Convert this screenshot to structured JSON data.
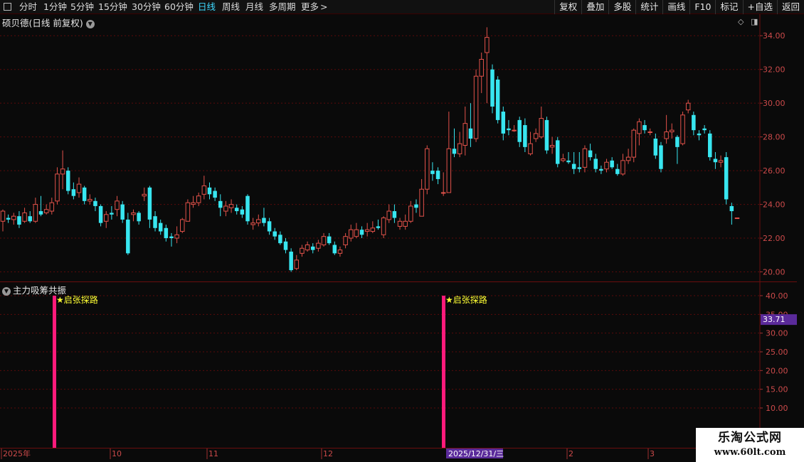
{
  "toolbar": {
    "periods": [
      "分时",
      "1分钟",
      "5分钟",
      "15分钟",
      "30分钟",
      "60分钟",
      "日线",
      "周线",
      "月线",
      "多周期",
      "更多"
    ],
    "active_period": "日线",
    "more_arrow": ">",
    "right_buttons": [
      "复权",
      "叠加",
      "多股",
      "统计",
      "画线",
      "F10",
      "标记",
      "+自选",
      "返回"
    ]
  },
  "main_chart": {
    "title": "硕贝德(日线 前复权)",
    "up_color": "#e2524a",
    "down_color": "#38e6f0",
    "grid_color": "#5a0a0a"
  },
  "indicator": {
    "title": "主力吸筹共振",
    "signal_label": "★启张探路",
    "signal_color": "#ff1a7a",
    "label_color": "#ffff33",
    "current_value": "33.71",
    "value_badge_color": "#5a2a9a"
  },
  "chart_data": [
    {
      "type": "candlestick",
      "title": "硕贝德(日线 前复权)",
      "y_ticks": [
        "34.00",
        "32.00",
        "30.00",
        "28.00",
        "26.00",
        "24.00",
        "22.00",
        "20.00"
      ],
      "ylim": [
        19.6,
        34.6
      ],
      "x_labels": [
        "2025年",
        "10",
        "11",
        "12",
        "2025/12/31/三",
        "2",
        "3"
      ],
      "candles": [
        [
          23.0,
          23.6,
          22.4,
          23.7
        ],
        [
          23.2,
          23.1,
          22.9,
          23.4
        ],
        [
          23.1,
          23.3,
          22.8,
          23.5
        ],
        [
          23.3,
          22.8,
          22.6,
          23.6
        ],
        [
          23.0,
          23.5,
          22.9,
          23.8
        ],
        [
          23.3,
          23.0,
          22.9,
          23.6
        ],
        [
          23.0,
          24.0,
          22.9,
          24.4
        ],
        [
          23.6,
          23.4,
          23.3,
          24.5
        ],
        [
          23.5,
          23.7,
          23.4,
          24.0
        ],
        [
          23.6,
          24.1,
          23.4,
          24.4
        ],
        [
          24.2,
          25.8,
          24.0,
          26.2
        ],
        [
          25.8,
          26.1,
          24.9,
          27.2
        ],
        [
          26.0,
          24.8,
          24.6,
          26.2
        ],
        [
          24.9,
          24.5,
          24.3,
          25.3
        ],
        [
          24.7,
          25.2,
          24.4,
          25.6
        ],
        [
          25.0,
          24.2,
          24.0,
          25.1
        ],
        [
          24.2,
          24.3,
          24.0,
          24.6
        ],
        [
          24.2,
          23.9,
          23.6,
          24.4
        ],
        [
          23.9,
          22.9,
          22.7,
          24.0
        ],
        [
          23.0,
          23.4,
          22.6,
          23.6
        ],
        [
          23.5,
          23.4,
          23.1,
          23.9
        ],
        [
          23.7,
          24.2,
          23.3,
          24.5
        ],
        [
          24.0,
          23.1,
          22.9,
          24.2
        ],
        [
          23.1,
          21.1,
          21.0,
          23.5
        ],
        [
          23.4,
          23.5,
          23.0,
          23.7
        ],
        [
          23.5,
          23.0,
          22.8,
          23.6
        ],
        [
          24.5,
          24.6,
          24.2,
          25.0
        ],
        [
          25.0,
          23.1,
          22.6,
          25.1
        ],
        [
          23.3,
          22.6,
          22.4,
          23.6
        ],
        [
          22.9,
          22.4,
          22.2,
          23.1
        ],
        [
          22.6,
          22.0,
          21.8,
          22.8
        ],
        [
          22.1,
          22.0,
          21.5,
          22.3
        ],
        [
          22.0,
          22.2,
          21.7,
          22.7
        ],
        [
          22.4,
          23.1,
          22.3,
          23.2
        ],
        [
          23.0,
          24.1,
          23.0,
          24.3
        ],
        [
          24.0,
          24.1,
          23.8,
          24.5
        ],
        [
          24.1,
          24.5,
          23.9,
          24.7
        ],
        [
          24.6,
          25.1,
          24.3,
          25.7
        ],
        [
          25.0,
          24.6,
          24.3,
          25.3
        ],
        [
          24.8,
          24.4,
          24.2,
          25.0
        ],
        [
          24.2,
          23.8,
          23.3,
          24.6
        ],
        [
          23.6,
          23.9,
          23.3,
          24.2
        ],
        [
          23.8,
          24.0,
          23.5,
          24.3
        ],
        [
          23.8,
          23.6,
          23.4,
          24.0
        ],
        [
          23.7,
          23.4,
          23.2,
          23.9
        ],
        [
          24.5,
          23.0,
          22.8,
          24.6
        ],
        [
          22.8,
          22.9,
          22.5,
          23.2
        ],
        [
          22.9,
          23.1,
          22.7,
          23.4
        ],
        [
          23.2,
          22.9,
          22.7,
          23.8
        ],
        [
          23.0,
          22.4,
          22.2,
          23.2
        ],
        [
          22.4,
          22.1,
          21.9,
          22.6
        ],
        [
          22.2,
          21.7,
          21.6,
          22.4
        ],
        [
          21.8,
          21.3,
          21.1,
          22.0
        ],
        [
          21.2,
          20.1,
          20.0,
          21.4
        ],
        [
          20.2,
          20.7,
          20.1,
          21.0
        ],
        [
          21.1,
          21.4,
          20.9,
          21.6
        ],
        [
          21.3,
          21.6,
          21.2,
          21.8
        ],
        [
          21.5,
          21.3,
          21.1,
          21.7
        ],
        [
          21.4,
          21.7,
          21.2,
          21.9
        ],
        [
          21.6,
          22.1,
          21.5,
          22.3
        ],
        [
          22.1,
          21.7,
          21.6,
          22.3
        ],
        [
          21.6,
          21.1,
          21.0,
          21.8
        ],
        [
          21.1,
          21.3,
          20.9,
          21.5
        ],
        [
          21.6,
          22.1,
          21.4,
          22.3
        ],
        [
          22.0,
          22.5,
          21.8,
          22.8
        ],
        [
          22.1,
          22.5,
          22.0,
          22.9
        ],
        [
          22.5,
          22.2,
          22.0,
          22.7
        ],
        [
          22.4,
          22.5,
          22.1,
          22.9
        ],
        [
          22.4,
          22.6,
          22.3,
          23.0
        ],
        [
          22.7,
          22.6,
          22.5,
          23.1
        ],
        [
          22.2,
          23.2,
          22.0,
          23.3
        ],
        [
          23.1,
          23.6,
          22.9,
          24.0
        ],
        [
          23.6,
          23.2,
          22.9,
          24.0
        ],
        [
          22.7,
          23.0,
          22.5,
          23.2
        ],
        [
          22.7,
          23.0,
          22.5,
          23.4
        ],
        [
          23.0,
          23.9,
          22.9,
          24.2
        ],
        [
          24.0,
          23.8,
          23.5,
          24.3
        ],
        [
          23.3,
          24.9,
          23.3,
          25.5
        ],
        [
          24.9,
          27.3,
          24.6,
          27.5
        ],
        [
          26.0,
          25.8,
          25.4,
          26.5
        ],
        [
          26.0,
          25.5,
          25.2,
          26.2
        ],
        [
          24.7,
          24.7,
          24.5,
          25.9
        ],
        [
          24.7,
          27.3,
          24.7,
          29.5
        ],
        [
          27.3,
          27.0,
          26.8,
          28.5
        ],
        [
          27.0,
          27.6,
          26.8,
          28.3
        ],
        [
          27.5,
          28.8,
          26.9,
          29.8
        ],
        [
          28.5,
          27.9,
          27.4,
          30.0
        ],
        [
          27.9,
          31.6,
          27.7,
          32.0
        ],
        [
          31.6,
          32.6,
          30.6,
          33.0
        ],
        [
          33.0,
          33.9,
          30.0,
          34.5
        ],
        [
          32.0,
          29.8,
          29.4,
          32.3
        ],
        [
          31.4,
          29.0,
          28.8,
          31.6
        ],
        [
          29.5,
          28.2,
          27.8,
          29.8
        ],
        [
          28.5,
          28.4,
          28.1,
          29.0
        ],
        [
          28.4,
          28.4,
          28.3,
          28.7
        ],
        [
          29.0,
          27.7,
          27.4,
          29.2
        ],
        [
          28.7,
          27.4,
          27.1,
          29.1
        ],
        [
          27.0,
          27.6,
          26.9,
          28.3
        ],
        [
          27.9,
          28.2,
          27.7,
          28.5
        ],
        [
          28.0,
          29.1,
          27.9,
          29.8
        ],
        [
          29.0,
          27.2,
          27.0,
          29.2
        ],
        [
          27.4,
          27.5,
          27.0,
          28.0
        ],
        [
          27.8,
          26.4,
          26.2,
          28.0
        ],
        [
          26.6,
          26.7,
          26.5,
          27.0
        ],
        [
          26.6,
          26.5,
          26.4,
          27.1
        ],
        [
          26.4,
          26.1,
          25.8,
          27.1
        ],
        [
          26.2,
          26.1,
          25.9,
          27.1
        ],
        [
          26.2,
          27.3,
          25.9,
          27.5
        ],
        [
          27.2,
          26.8,
          26.6,
          27.6
        ],
        [
          26.7,
          26.1,
          25.9,
          27.0
        ],
        [
          26.1,
          26.0,
          25.8,
          26.3
        ],
        [
          26.1,
          26.5,
          25.9,
          26.7
        ],
        [
          26.6,
          26.2,
          26.1,
          26.8
        ],
        [
          26.1,
          25.8,
          25.7,
          26.4
        ],
        [
          25.8,
          26.6,
          25.7,
          27.0
        ],
        [
          26.6,
          26.8,
          26.4,
          27.3
        ],
        [
          26.8,
          28.4,
          26.5,
          28.5
        ],
        [
          28.2,
          28.9,
          27.5,
          29.1
        ],
        [
          28.7,
          28.4,
          28.2,
          29.0
        ],
        [
          28.3,
          28.3,
          28.1,
          28.5
        ],
        [
          27.9,
          26.9,
          26.7,
          28.2
        ],
        [
          27.5,
          26.1,
          25.9,
          27.7
        ],
        [
          27.9,
          28.3,
          27.6,
          29.3
        ],
        [
          28.3,
          28.4,
          27.9,
          28.8
        ],
        [
          28.0,
          27.4,
          26.4,
          28.1
        ],
        [
          27.6,
          29.3,
          27.5,
          29.5
        ],
        [
          29.6,
          30.0,
          29.4,
          30.2
        ],
        [
          29.3,
          28.4,
          28.1,
          29.5
        ],
        [
          28.2,
          28.1,
          27.8,
          28.4
        ],
        [
          28.5,
          28.4,
          28.2,
          28.7
        ],
        [
          28.2,
          26.8,
          26.6,
          28.4
        ],
        [
          26.7,
          26.5,
          26.1,
          27.1
        ],
        [
          26.5,
          26.6,
          26.2,
          26.9
        ],
        [
          26.8,
          24.3,
          24.0,
          27.1
        ],
        [
          23.9,
          23.6,
          22.8,
          24.1
        ],
        [
          23.2,
          23.2,
          23.2,
          23.2
        ]
      ]
    },
    {
      "type": "bar",
      "title": "主力吸筹共振",
      "y_ticks": [
        "40.00",
        "35.00",
        "30.00",
        "25.00",
        "20.00",
        "15.00",
        "10.00"
      ],
      "ylim": [
        0,
        42
      ],
      "bars": [
        {
          "label": "★启张探路",
          "value": 40
        },
        {
          "label": "★启张探路",
          "value": 40
        }
      ]
    }
  ],
  "watermark": {
    "line1": "乐淘公式网",
    "line2": "www.60lt.com"
  }
}
